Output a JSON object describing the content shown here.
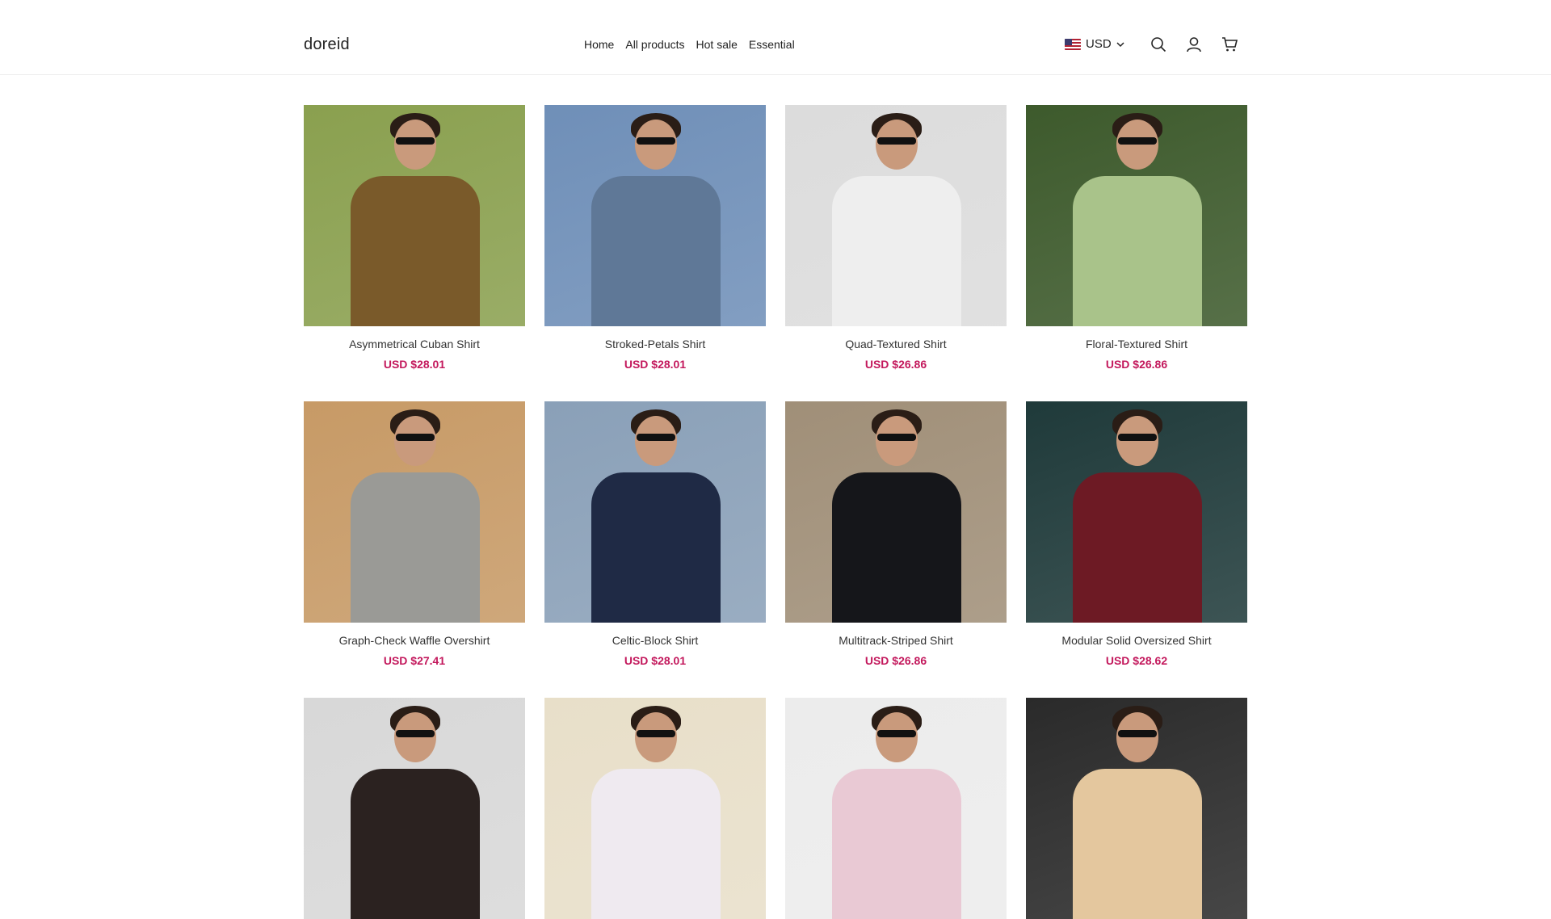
{
  "header": {
    "logo": "doreid",
    "nav": [
      "Home",
      "All products",
      "Hot sale",
      "Essential"
    ],
    "currency": {
      "code": "USD",
      "flag_icon": "us-flag-icon"
    },
    "icons": [
      "search-icon",
      "account-icon",
      "cart-icon"
    ]
  },
  "products": [
    {
      "name": "Asymmetrical Cuban Shirt",
      "price": "USD $28.01",
      "shirt_color": "#7a5a2a",
      "bg": "#8aa04f"
    },
    {
      "name": "Stroked-Petals Shirt",
      "price": "USD $28.01",
      "shirt_color": "#5f7897",
      "bg": "#6f8fb8"
    },
    {
      "name": "Quad-Textured Shirt",
      "price": "USD $26.86",
      "shirt_color": "#eeeeee",
      "bg": "#dcdcdc"
    },
    {
      "name": "Floral-Textured Shirt",
      "price": "USD $26.86",
      "shirt_color": "#a9c38a",
      "bg": "#3d5a2c"
    },
    {
      "name": "Graph-Check Waffle Overshirt",
      "price": "USD $27.41",
      "shirt_color": "#9a9a96",
      "bg": "#c79a66"
    },
    {
      "name": "Celtic-Block Shirt",
      "price": "USD $28.01",
      "shirt_color": "#1f2a45",
      "bg": "#8aa0b8"
    },
    {
      "name": "Multitrack-Striped Shirt",
      "price": "USD $26.86",
      "shirt_color": "#15161a",
      "bg": "#a08f78"
    },
    {
      "name": "Modular Solid Oversized Shirt",
      "price": "USD $28.62",
      "shirt_color": "#6d1a24",
      "bg": "#1f3a3a"
    },
    {
      "name": "",
      "price": "",
      "shirt_color": "#2b2220",
      "bg": "#d8d8d8"
    },
    {
      "name": "",
      "price": "",
      "shirt_color": "#efeaf0",
      "bg": "#e8dfc9"
    },
    {
      "name": "",
      "price": "",
      "shirt_color": "#e9c9d4",
      "bg": "#ececec"
    },
    {
      "name": "",
      "price": "",
      "shirt_color": "#e4c79e",
      "bg": "#2a2a2a"
    }
  ]
}
